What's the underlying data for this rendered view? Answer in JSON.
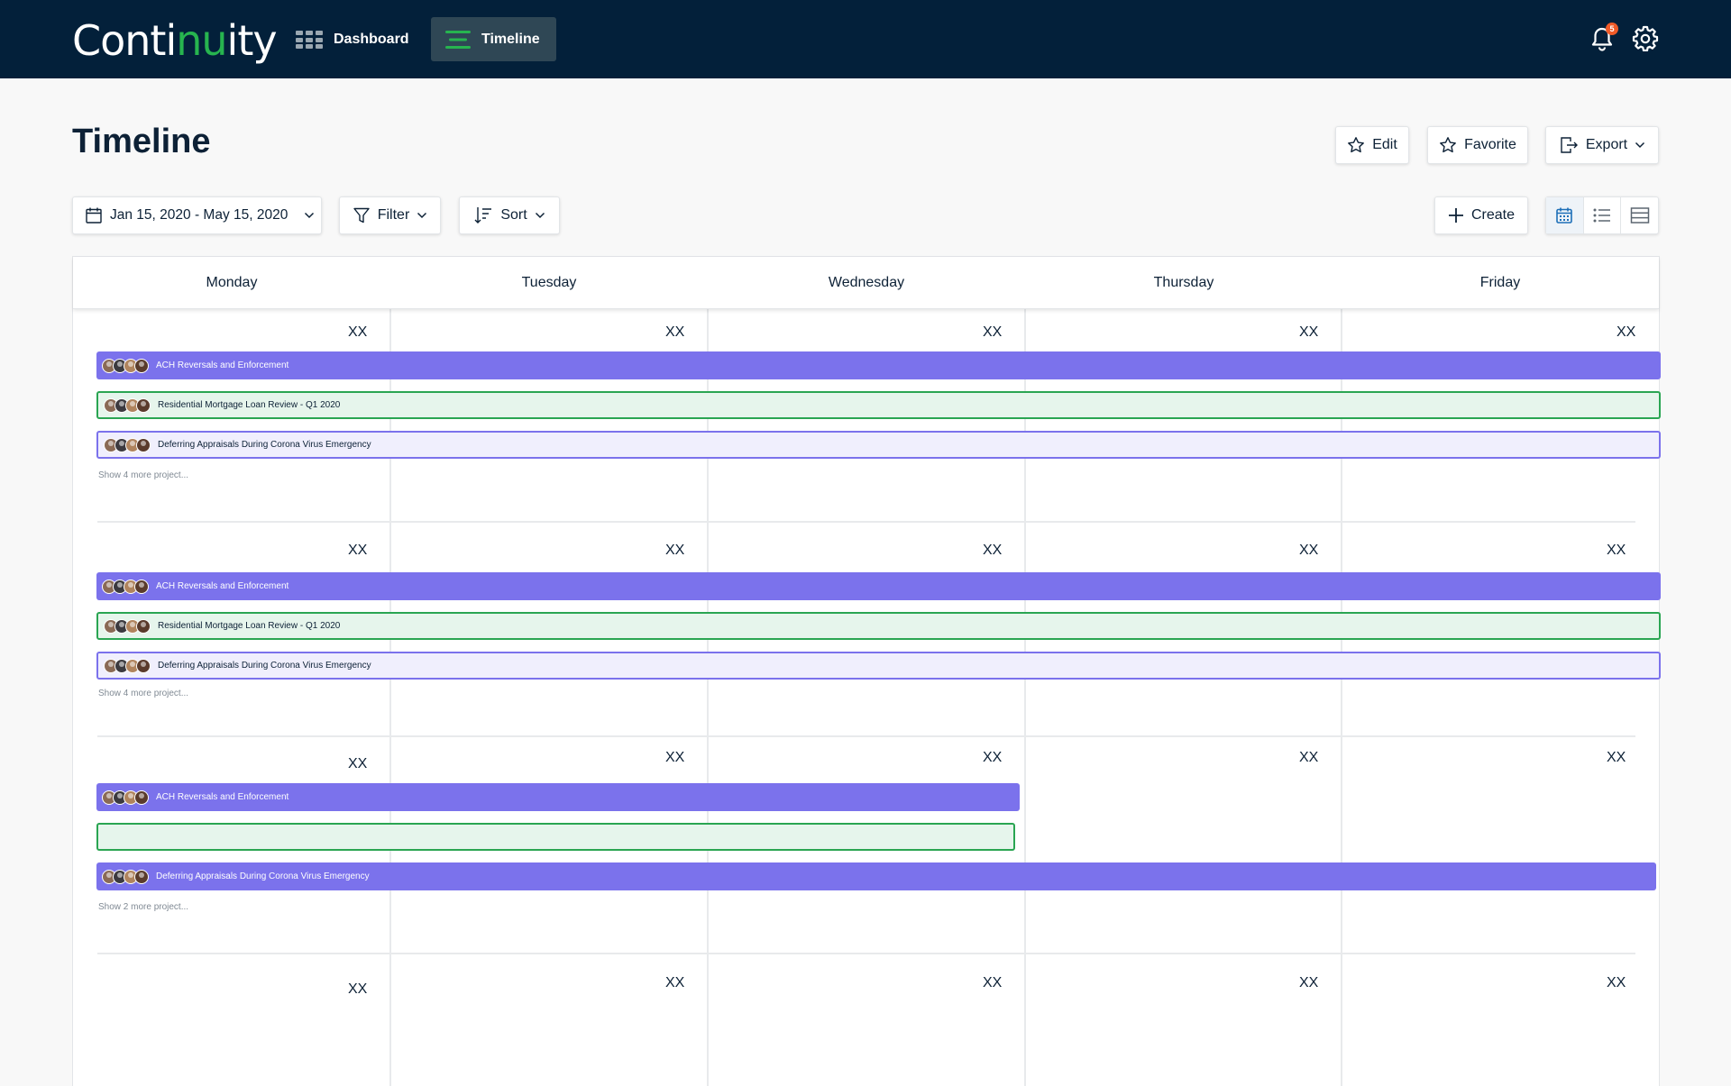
{
  "app": {
    "logo_prefix": "Conti",
    "logo_accent": "nu",
    "logo_suffix": "ity"
  },
  "nav": {
    "dashboard": "Dashboard",
    "timeline": "Timeline",
    "notification_count": "5"
  },
  "page": {
    "title": "Timeline",
    "edit": "Edit",
    "favorite": "Favorite",
    "export": "Export"
  },
  "toolbar": {
    "date_range": "Jan 15, 2020 - May 15, 2020",
    "filter": "Filter",
    "sort": "Sort",
    "create": "Create",
    "active_view": "calendar"
  },
  "calendar": {
    "days": [
      "Monday",
      "Tuesday",
      "Wednesday",
      "Thursday",
      "Friday"
    ],
    "weeks": [
      {
        "dates": [
          "XX",
          "XX",
          "XX",
          "XX",
          "XX"
        ],
        "projects": [
          {
            "title": "ACH Reversals and Enforcement",
            "style": "purple"
          },
          {
            "title": "Residential Mortgage Loan Review - Q1 2020",
            "style": "green"
          },
          {
            "title": "Deferring Appraisals During Corona Virus Emergency",
            "style": "lavender"
          }
        ],
        "more": "Show 4 more project..."
      },
      {
        "dates": [
          "XX",
          "XX",
          "XX",
          "XX",
          "XX"
        ],
        "projects": [
          {
            "title": "ACH Reversals and Enforcement",
            "style": "purple"
          },
          {
            "title": "Residential Mortgage Loan Review - Q1 2020",
            "style": "green"
          },
          {
            "title": "Deferring Appraisals During Corona Virus Emergency",
            "style": "lavender"
          }
        ],
        "more": "Show 4 more project..."
      },
      {
        "dates": [
          "XX",
          "XX",
          "XX",
          "XX",
          "XX"
        ],
        "projects": [
          {
            "title": "ACH Reversals and Enforcement",
            "style": "purple"
          },
          {
            "title": "",
            "style": "green"
          },
          {
            "title": "Deferring Appraisals During Corona Virus Emergency",
            "style": "purple"
          }
        ],
        "more": "Show 2 more project..."
      },
      {
        "dates": [
          "XX",
          "XX",
          "XX",
          "XX",
          "XX"
        ],
        "projects": [],
        "more": ""
      }
    ]
  },
  "colors": {
    "topbar": "#03203a",
    "brand_green": "#27b44f",
    "purple": "#7b72ec",
    "green_border": "#2aa552",
    "badge": "#ef5a28"
  }
}
